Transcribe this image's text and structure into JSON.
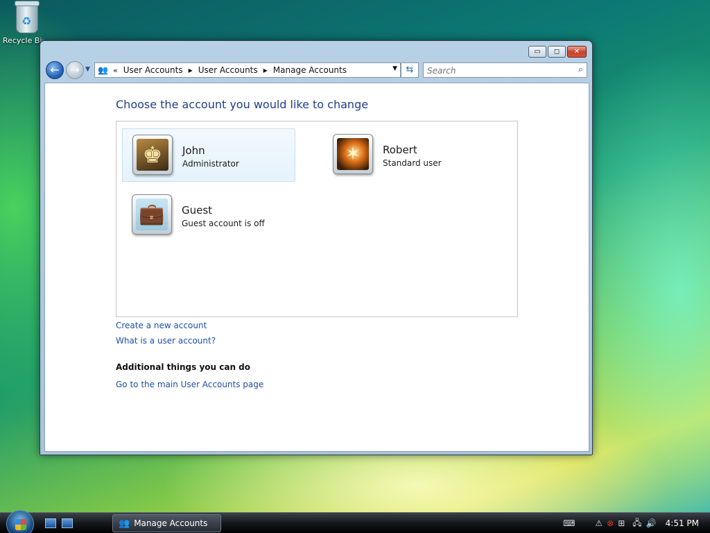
{
  "desktop": {
    "recycle_bin_label": "Recycle Bin"
  },
  "window": {
    "caption": {
      "minimize": "▭",
      "maximize": "◻",
      "close": "✕"
    },
    "nav": {
      "back_icon": "back-arrow-icon",
      "forward_icon": "forward-arrow-icon",
      "address_chevron": "«",
      "breadcrumbs": [
        "User Accounts",
        "User Accounts",
        "Manage Accounts"
      ],
      "search_placeholder": "Search"
    },
    "content": {
      "heading": "Choose the account you would like to change",
      "accounts": [
        {
          "name": "John",
          "role": "Administrator",
          "picture": "chess-icon"
        },
        {
          "name": "Robert",
          "role": "Standard user",
          "picture": "sparkle-icon"
        },
        {
          "name": "Guest",
          "role": "Guest account is off",
          "picture": "suitcase-icon"
        }
      ],
      "links": {
        "create": "Create a new account",
        "what_is": "What is a user account?"
      },
      "additional_heading": "Additional things you can do",
      "main_page_link": "Go to the main User Accounts page"
    }
  },
  "taskbar": {
    "task_label": "Manage Accounts",
    "clock": "4:51 PM"
  },
  "colors": {
    "link": "#1e4ea8",
    "heading": "#1e3e8c",
    "selected_bg": "#e5f2fc"
  }
}
